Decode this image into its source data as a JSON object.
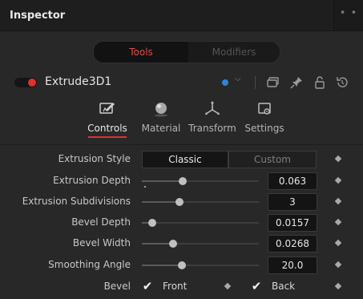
{
  "window": {
    "title": "Inspector",
    "more_label": "• • •"
  },
  "mode_tabs": {
    "tools": "Tools",
    "modifiers": "Modifiers"
  },
  "node": {
    "name": "Extrude3D1"
  },
  "tabs": [
    {
      "label": "Controls",
      "active": true
    },
    {
      "label": "Material",
      "active": false
    },
    {
      "label": "Transform",
      "active": false
    },
    {
      "label": "Settings",
      "active": false
    }
  ],
  "controls": {
    "extrusion_style": {
      "label": "Extrusion Style",
      "options": [
        "Classic",
        "Custom"
      ],
      "selected": "Classic"
    },
    "extrusion_depth": {
      "label": "Extrusion Depth",
      "value": "0.063",
      "fraction": 0.35
    },
    "extrusion_subdivisions": {
      "label": "Extrusion Subdivisions",
      "value": "3",
      "fraction": 0.32
    },
    "bevel_depth": {
      "label": "Bevel Depth",
      "value": "0.0157",
      "fraction": 0.09
    },
    "bevel_width": {
      "label": "Bevel Width",
      "value": "0.0268",
      "fraction": 0.27
    },
    "smoothing_angle": {
      "label": "Smoothing Angle",
      "value": "20.0",
      "fraction": 0.34
    },
    "bevel": {
      "label": "Bevel",
      "front_label": "Front",
      "back_label": "Back",
      "front_checked": true,
      "back_checked": true
    }
  },
  "colors": {
    "accent_red": "#e0302f",
    "node_blue": "#2f84d6",
    "background": "#282828"
  },
  "icons": {
    "toolbar": [
      "blue-dot",
      "chevron-down-icon",
      "windows-icon",
      "pin-icon",
      "lock-icon",
      "reset-icon"
    ],
    "tabs": [
      "controls-icon",
      "material-icon",
      "transform-icon",
      "settings-icon"
    ]
  }
}
